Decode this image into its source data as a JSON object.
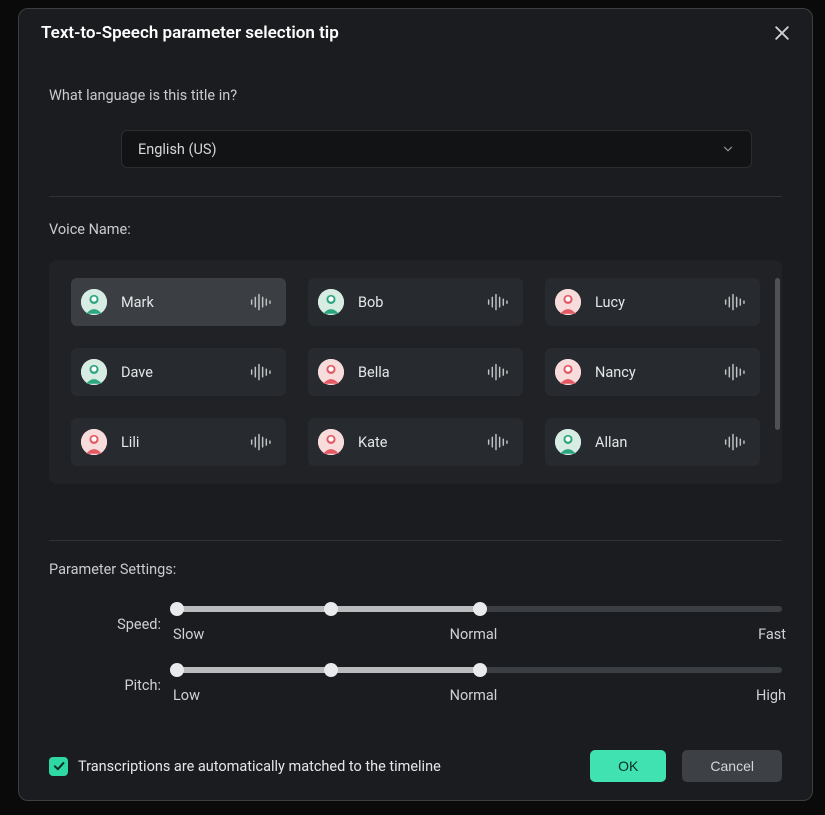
{
  "dialog": {
    "title": "Text-to-Speech parameter selection tip"
  },
  "language": {
    "label": "What language is this title in?",
    "selected": "English (US)"
  },
  "voice": {
    "label": "Voice Name:",
    "items": [
      {
        "name": "Mark",
        "avatar": "green",
        "selected": true
      },
      {
        "name": "Bob",
        "avatar": "green",
        "selected": false
      },
      {
        "name": "Lucy",
        "avatar": "pink",
        "selected": false
      },
      {
        "name": "Dave",
        "avatar": "green",
        "selected": false
      },
      {
        "name": "Bella",
        "avatar": "pink",
        "selected": false
      },
      {
        "name": "Nancy",
        "avatar": "pink",
        "selected": false
      },
      {
        "name": "Lili",
        "avatar": "pink",
        "selected": false
      },
      {
        "name": "Kate",
        "avatar": "pink",
        "selected": false
      },
      {
        "name": "Allan",
        "avatar": "green",
        "selected": false
      }
    ]
  },
  "params": {
    "title": "Parameter Settings:",
    "speed": {
      "label": "Speed:",
      "value_percent": 50,
      "ticks": {
        "low": "Slow",
        "mid": "Normal",
        "high": "Fast"
      }
    },
    "pitch": {
      "label": "Pitch:",
      "value_percent": 50,
      "ticks": {
        "low": "Low",
        "mid": "Normal",
        "high": "High"
      }
    }
  },
  "footer": {
    "checkbox_checked": true,
    "checkbox_label": "Transcriptions are automatically matched to the timeline",
    "ok_label": "OK",
    "cancel_label": "Cancel"
  },
  "colors": {
    "accent": "#3fe2b0",
    "avatar_green": "#2da67f",
    "avatar_pink": "#e45a64"
  }
}
